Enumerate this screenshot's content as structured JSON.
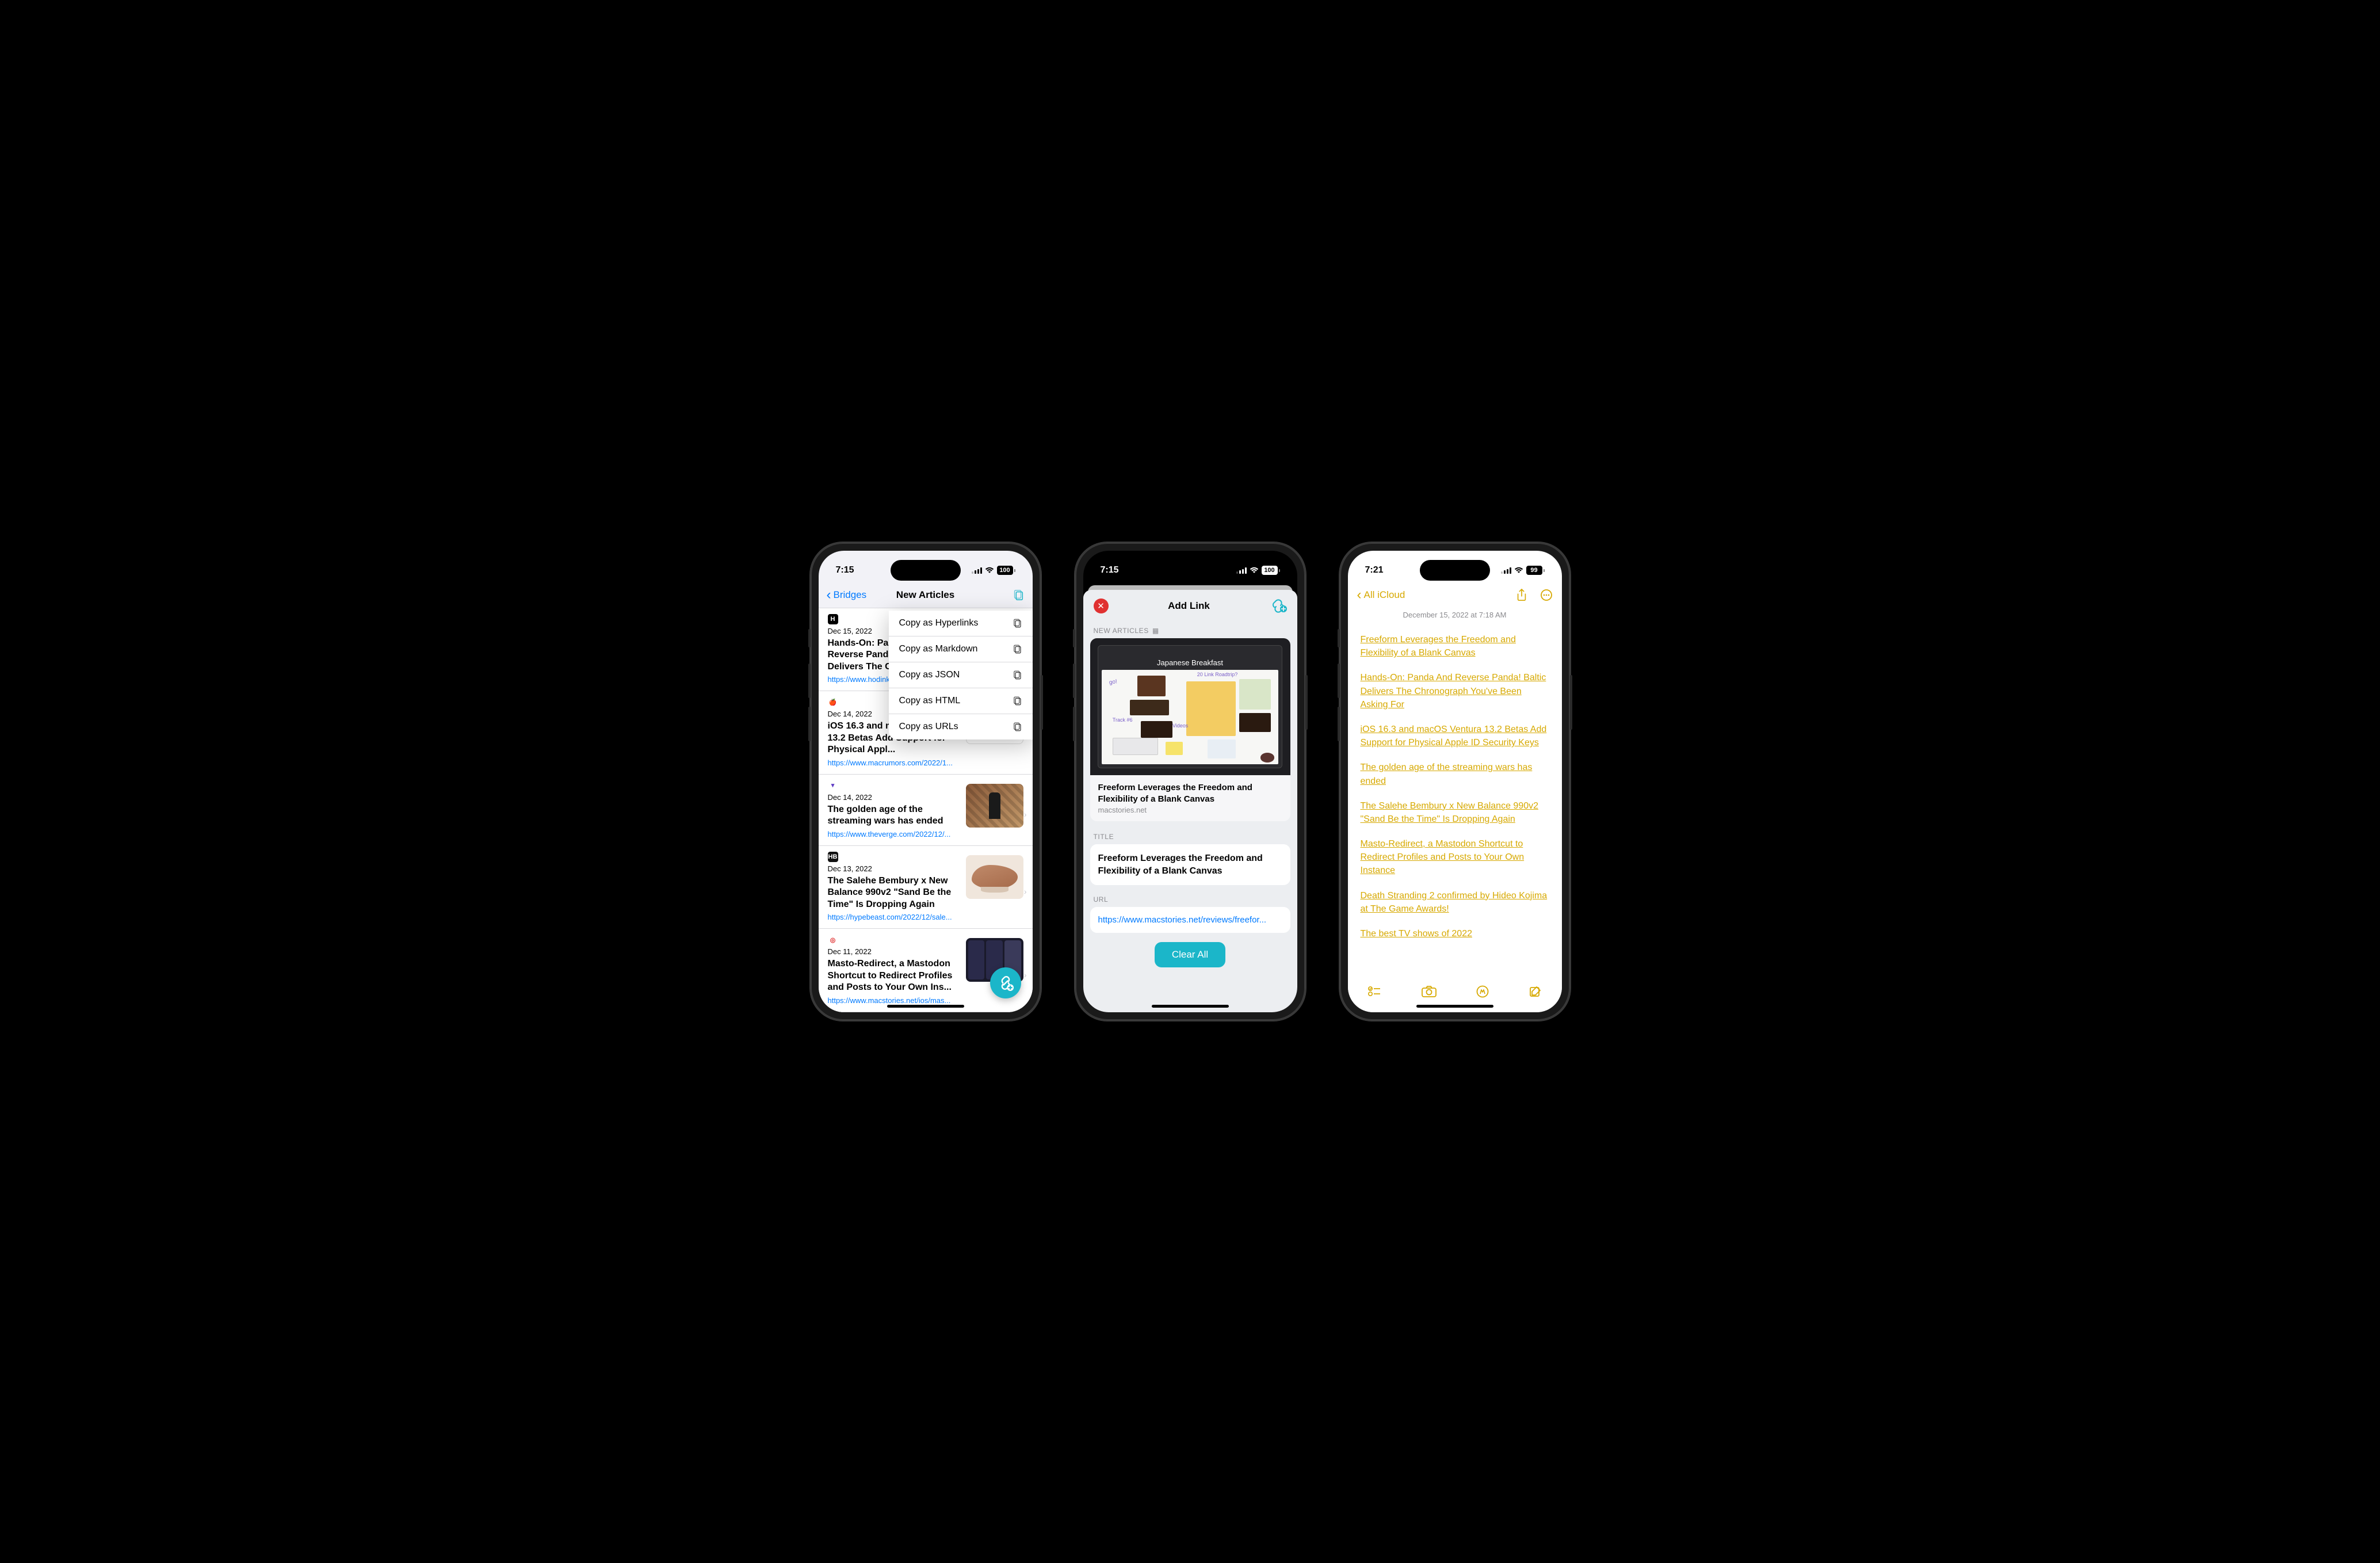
{
  "status": {
    "time1": "7:15",
    "time2": "7:15",
    "time3": "7:21",
    "battery12": "100",
    "battery3": "99"
  },
  "phone1": {
    "back_label": "Bridges",
    "nav_title": "New Articles",
    "popover": [
      "Copy as Hyperlinks",
      "Copy as Markdown",
      "Copy as JSON",
      "Copy as HTML",
      "Copy as URLs"
    ],
    "articles": [
      {
        "date": "Dec 15, 2022",
        "title": "Hands-On: Panda And Reverse Panda! Baltic Delivers The Chronograph You've Been Asking For",
        "url": "https://www.hodinkee.com/...",
        "favbg": "#000",
        "favtxt": "H",
        "favcolor": "#fff"
      },
      {
        "date": "Dec 14, 2022",
        "title": "iOS 16.3 and macOS Ventura 13.2 Betas Add Support for Physical Appl...",
        "url": "https://www.macrumors.com/2022/1...",
        "favbg": "#fff",
        "favtxt": "🍎",
        "favcolor": "#d33"
      },
      {
        "date": "Dec 14, 2022",
        "title": "The golden age of the streaming wars has ended",
        "url": "https://www.theverge.com/2022/12/...",
        "favbg": "#fff",
        "favtxt": "▾",
        "favcolor": "#5f3dc4"
      },
      {
        "date": "Dec 13, 2022",
        "title": "The Salehe Bembury x New Balance 990v2 \"Sand Be the Time\" Is Dropping Again",
        "url": "https://hypebeast.com/2022/12/sale...",
        "favbg": "#111",
        "favtxt": "HB",
        "favcolor": "#fff"
      },
      {
        "date": "Dec 11, 2022",
        "title": "Masto-Redirect, a Mastodon Shortcut to Redirect Profiles and Posts to Your Own Ins...",
        "url": "https://www.macstories.net/ios/mas...",
        "favbg": "#fff",
        "favtxt": "◎",
        "favcolor": "#e03131"
      }
    ]
  },
  "phone2": {
    "modal_title": "Add Link",
    "section_label": "NEW ARTICLES",
    "preview": {
      "board_title": "Japanese Breakfast",
      "title": "Freeform Leverages the Freedom and Flexibility of a Blank Canvas",
      "domain": "macstories.net"
    },
    "title_label": "TITLE",
    "title_value": "Freeform Leverages the Freedom and Flexibility of a Blank Canvas",
    "url_label": "URL",
    "url_value": "https://www.macstories.net/reviews/freefor...",
    "clear_label": "Clear All"
  },
  "phone3": {
    "back_label": "All iCloud",
    "timestamp": "December 15, 2022 at 7:18 AM",
    "links": [
      "Freeform Leverages the Freedom and Flexibility of a Blank Canvas",
      "Hands-On: Panda And Reverse Panda! Baltic Delivers The Chronograph You've Been Asking For",
      "iOS 16.3 and macOS Ventura 13.2 Betas Add Support for Physical Apple ID Security Keys",
      "The golden age of the streaming wars has ended",
      "The Salehe Bembury x New Balance 990v2 \"Sand Be the Time\" Is Dropping Again",
      "Masto-Redirect, a Mastodon Shortcut to Redirect Profiles and Posts to Your Own Instance",
      "Death Stranding 2 confirmed by Hideo Kojima at The Game Awards!",
      "The best TV shows of 2022"
    ]
  }
}
